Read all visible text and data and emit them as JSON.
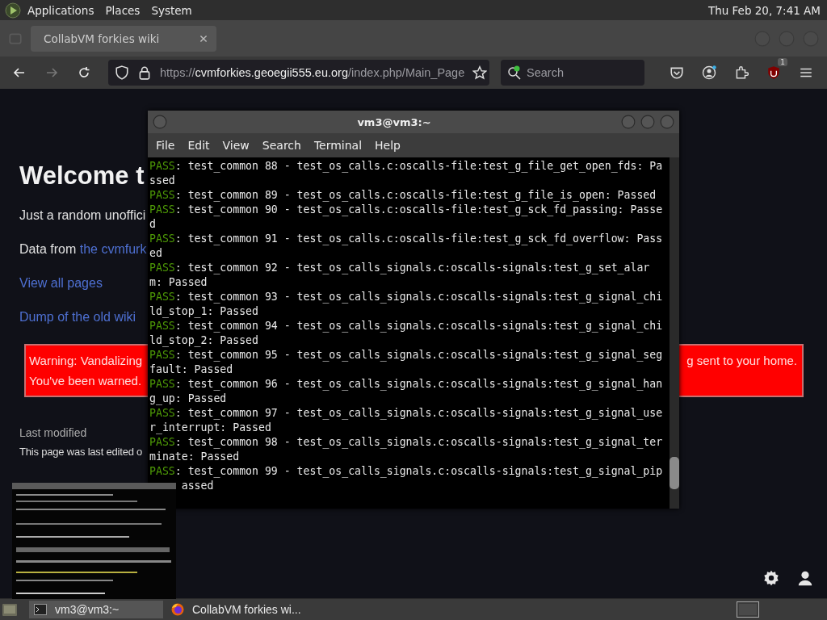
{
  "top_panel": {
    "menus": [
      "Applications",
      "Places",
      "System"
    ],
    "clock": "Thu Feb 20, 7:41 AM"
  },
  "browser": {
    "tabs": [
      {
        "title": "CollabVM forkies wiki",
        "selected": true
      }
    ],
    "nav_buttons": [
      {
        "kind": "back",
        "disabled": false
      },
      {
        "kind": "forward",
        "disabled": true
      },
      {
        "kind": "reload",
        "disabled": false
      }
    ],
    "url": {
      "scheme": "https://",
      "host": "cvmforkies.geoegii555.eu.org",
      "path": "/index.php/Main_Page"
    },
    "search": {
      "placeholder": "Search"
    },
    "extension_badge": "1"
  },
  "page": {
    "title": "Welcome t",
    "lines": [
      {
        "kind": "text",
        "text": "Just a random unoffici"
      },
      {
        "kind": "mixed",
        "text": "Data from ",
        "link": "the cvmfurk"
      },
      {
        "kind": "link",
        "text": "View all pages"
      },
      {
        "kind": "link",
        "text": "Dump of the old wiki"
      }
    ],
    "warning": {
      "line_1_start": "Warning: Vandalizing",
      "line_1_end": "g sent to your home.",
      "line_2": "You've been warned."
    },
    "footer": {
      "heading": "Last modified",
      "text": "This page was last edited o"
    }
  },
  "terminal": {
    "title": "vm3@vm3:~",
    "menu": [
      "File",
      "Edit",
      "View",
      "Search",
      "Terminal",
      "Help"
    ],
    "lines": [
      {
        "status": "PASS",
        "text": ": test_common 88 - test_os_calls.c:oscalls-file:test_g_file_get_open_fds: Passed"
      },
      {
        "status": "PASS",
        "text": ": test_common 89 - test_os_calls.c:oscalls-file:test_g_file_is_open: Passed"
      },
      {
        "status": "PASS",
        "text": ": test_common 90 - test_os_calls.c:oscalls-file:test_g_sck_fd_passing: Passed"
      },
      {
        "status": "PASS",
        "text": ": test_common 91 - test_os_calls.c:oscalls-file:test_g_sck_fd_overflow: Passed"
      },
      {
        "status": "PASS",
        "text": ": test_common 92 - test_os_calls_signals.c:oscalls-signals:test_g_set_alarm: Passed"
      },
      {
        "status": "PASS",
        "text": ": test_common 93 - test_os_calls_signals.c:oscalls-signals:test_g_signal_child_stop_1: Passed"
      },
      {
        "status": "PASS",
        "text": ": test_common 94 - test_os_calls_signals.c:oscalls-signals:test_g_signal_child_stop_2: Passed"
      },
      {
        "status": "PASS",
        "text": ": test_common 95 - test_os_calls_signals.c:oscalls-signals:test_g_signal_segfault: Passed"
      },
      {
        "status": "PASS",
        "text": ": test_common 96 - test_os_calls_signals.c:oscalls-signals:test_g_signal_hang_up: Passed"
      },
      {
        "status": "PASS",
        "text": ": test_common 97 - test_os_calls_signals.c:oscalls-signals:test_g_signal_user_interrupt: Passed"
      },
      {
        "status": "PASS",
        "text": ": test_common 98 - test_os_calls_signals.c:oscalls-signals:test_g_signal_terminate: Passed"
      },
      {
        "status": "PASS",
        "text": ": test_common 99 - test_os_calls_signals.c:oscalls-signals:test_g_signal_pip",
        "tail": "assed"
      }
    ]
  },
  "taskbar": {
    "items": [
      {
        "kind": "terminal",
        "label": "vm3@vm3:~",
        "selected": true
      },
      {
        "kind": "browser",
        "label": "CollabVM forkies wi...",
        "selected": false
      }
    ]
  }
}
